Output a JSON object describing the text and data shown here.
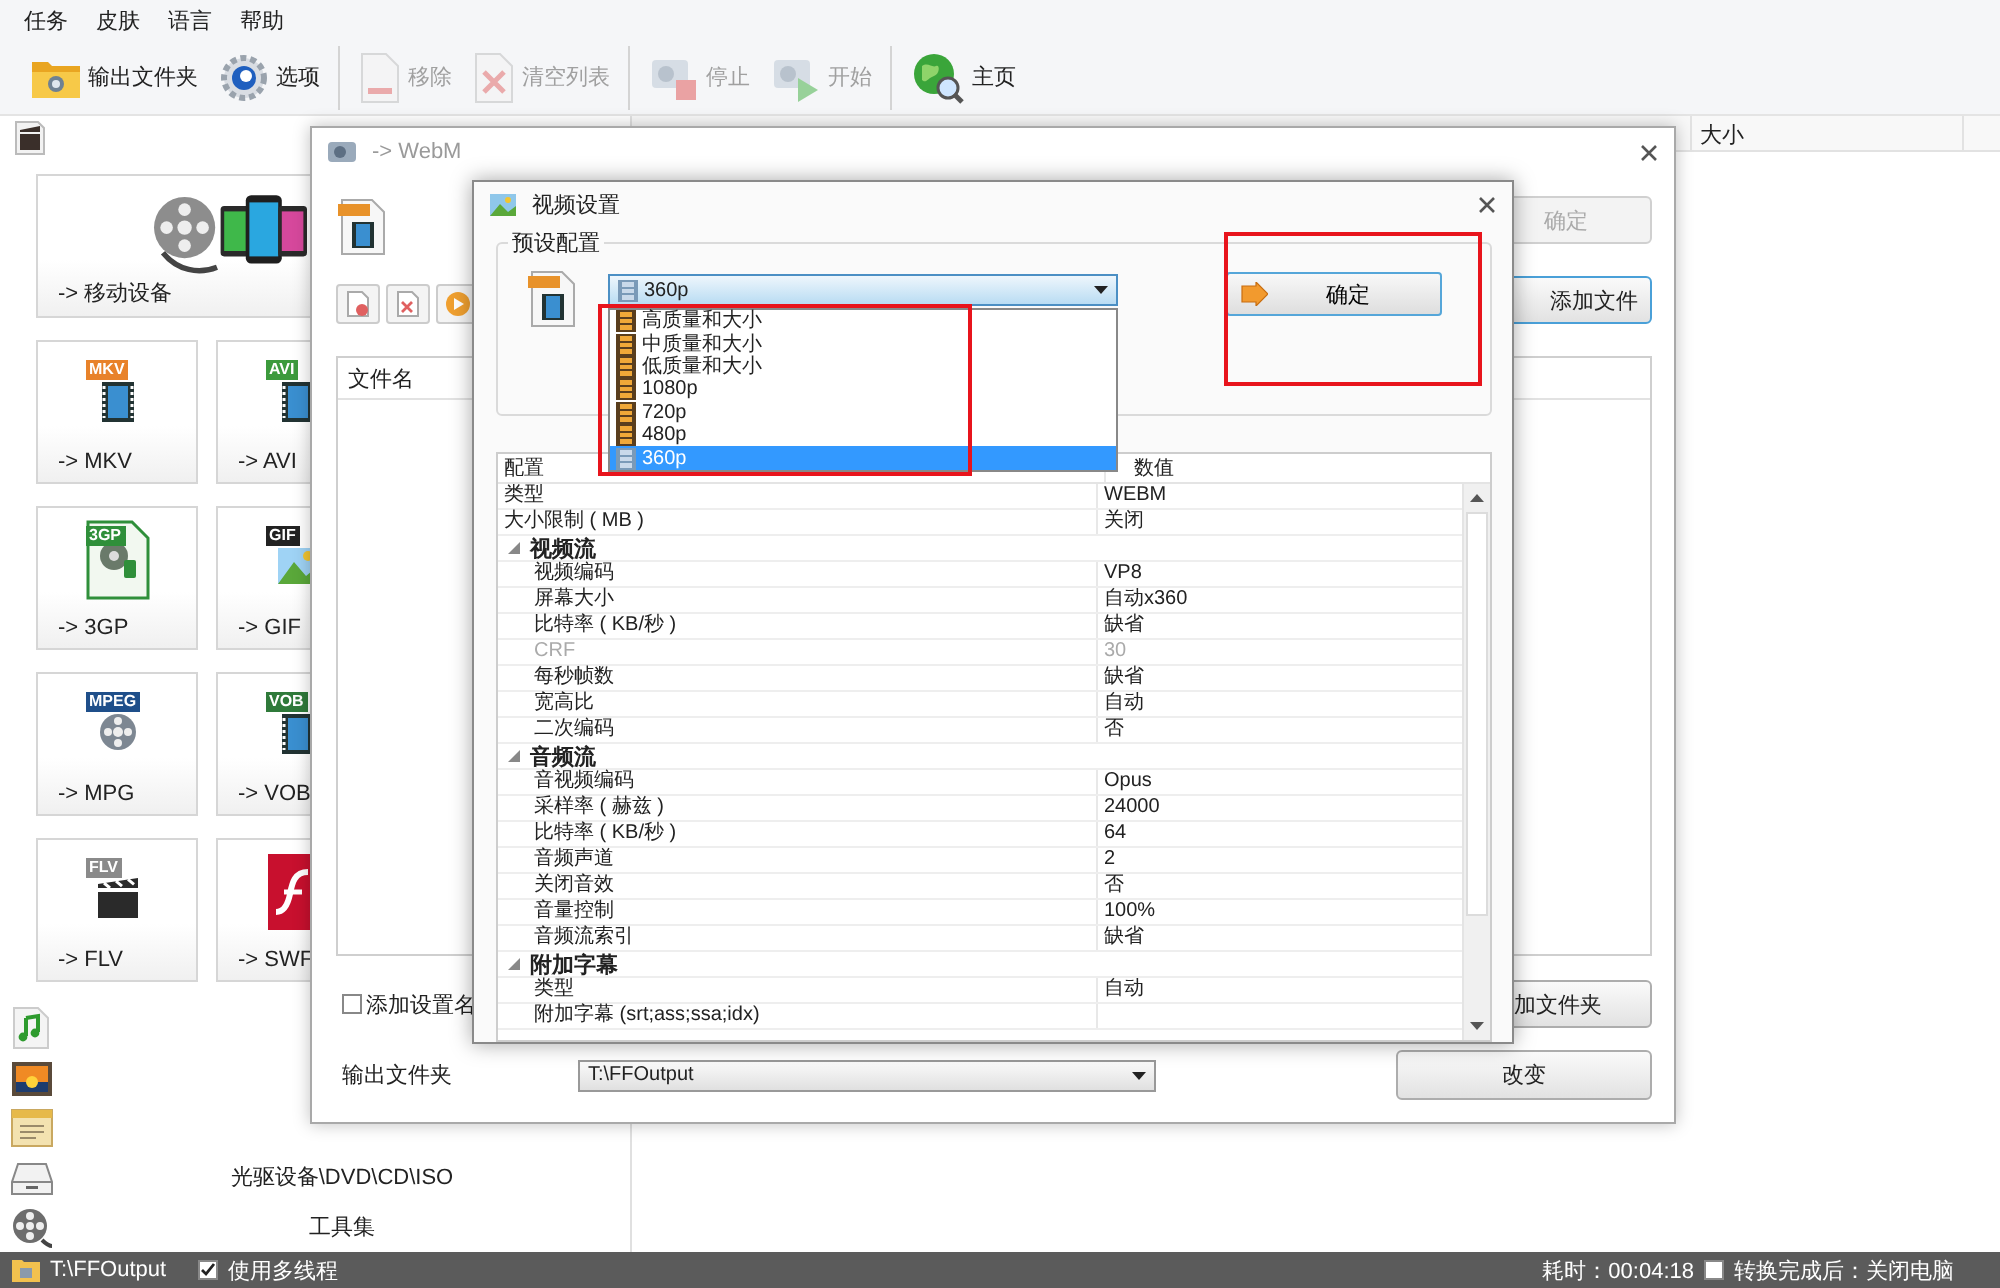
{
  "menu": [
    {
      "label": "任务"
    },
    {
      "label": "皮肤"
    },
    {
      "label": "语言"
    },
    {
      "label": "帮助"
    }
  ],
  "toolbar": [
    [
      {
        "label": "输出文件夹",
        "kind": "folder",
        "disabled": false
      },
      {
        "label": "选项",
        "kind": "gear",
        "disabled": false
      }
    ],
    [
      {
        "label": "移除",
        "kind": "remove",
        "disabled": true
      },
      {
        "label": "清空列表",
        "kind": "clear",
        "disabled": true
      }
    ],
    [
      {
        "label": "停止",
        "kind": "stop",
        "disabled": true
      },
      {
        "label": "开始",
        "kind": "start",
        "disabled": true
      }
    ],
    [
      {
        "label": "主页",
        "kind": "globe",
        "disabled": false
      }
    ]
  ],
  "left_panel": {
    "featured_tile": {
      "label": "-> 移动设备"
    },
    "tiles": [
      {
        "label": "-> MKV",
        "badge": "MKV",
        "kind": "film",
        "color": "#e8822a"
      },
      {
        "label": "-> AVI",
        "badge": "AVI",
        "kind": "film",
        "color": "#3c9a3c"
      },
      {
        "label": "-> 3GP",
        "badge": "3GP",
        "kind": "phone",
        "color": "#2f8f3a"
      },
      {
        "label": "-> GIF",
        "badge": "GIF",
        "kind": "image",
        "color": "#222222"
      },
      {
        "label": "-> MPG",
        "badge": "MPEG",
        "kind": "reel",
        "color": "#1f4f8a"
      },
      {
        "label": "-> VOB",
        "badge": "VOB",
        "kind": "film",
        "color": "#2f7a3a"
      },
      {
        "label": "-> FLV",
        "badge": "FLV",
        "kind": "clapper",
        "color": "#8a8a8a"
      },
      {
        "label": "-> SWF",
        "kind": "flash"
      }
    ],
    "sidebar_items": [
      {
        "kind": "music"
      },
      {
        "kind": "image"
      },
      {
        "kind": "document"
      },
      {
        "kind": "disc",
        "label": "光驱设备\\DVD\\CD\\ISO"
      },
      {
        "kind": "tools",
        "label": "工具集"
      }
    ]
  },
  "file_table": {
    "columns": [
      {
        "label": "大小"
      }
    ]
  },
  "webm_window": {
    "title": "-> WebM",
    "ok_button": {
      "label": "确定",
      "disabled": true
    },
    "add_file_button": {
      "label": "添加文件"
    },
    "list_columns": [
      {
        "label": "文件名"
      }
    ],
    "name_checkbox": {
      "label": "添加设置名",
      "checked": false
    },
    "add_folder_button": {
      "label": "加文件夹"
    },
    "output_label": "输出文件夹",
    "output_select": {
      "value": "T:\\FFOutput"
    },
    "change_button": {
      "label": "改变"
    }
  },
  "video_settings": {
    "title": "视频设置",
    "preset_group": "预设配置",
    "preset_select": {
      "value": "360p",
      "expanded": true
    },
    "preset_options": [
      {
        "label": "高质量和大小",
        "selected": false
      },
      {
        "label": "中质量和大小",
        "selected": false
      },
      {
        "label": "低质量和大小",
        "selected": false
      },
      {
        "label": "1080p",
        "selected": false
      },
      {
        "label": "720p",
        "selected": false
      },
      {
        "label": "480p",
        "selected": false
      },
      {
        "label": "360p",
        "selected": true
      }
    ],
    "ok_button": {
      "label": "确定"
    },
    "grid": {
      "columns": [
        {
          "label": "配置"
        },
        {
          "label": "数值"
        }
      ],
      "rows": [
        {
          "kind": "property",
          "name": "类型",
          "value": "WEBM",
          "disabled": false
        },
        {
          "kind": "property",
          "name": "大小限制 ( MB )",
          "value": "关闭",
          "disabled": false
        },
        {
          "kind": "category",
          "name": "视频流",
          "expanded": true,
          "children": [
            {
              "kind": "property",
              "name": "视频编码",
              "value": "VP8",
              "disabled": false
            },
            {
              "kind": "property",
              "name": "屏幕大小",
              "value": "自动x360",
              "disabled": false
            },
            {
              "kind": "property",
              "name": "比特率 ( KB/秒 )",
              "value": "缺省",
              "disabled": false
            },
            {
              "kind": "property",
              "name": "CRF",
              "value": "30",
              "disabled": true
            },
            {
              "kind": "property",
              "name": "每秒帧数",
              "value": "缺省",
              "disabled": false
            },
            {
              "kind": "property",
              "name": "宽高比",
              "value": "自动",
              "disabled": false
            },
            {
              "kind": "property",
              "name": "二次编码",
              "value": "否",
              "disabled": false
            }
          ]
        },
        {
          "kind": "category",
          "name": "音频流",
          "expanded": true,
          "children": [
            {
              "kind": "property",
              "name": "音视频编码",
              "value": "Opus",
              "disabled": false
            },
            {
              "kind": "property",
              "name": "采样率 ( 赫兹 )",
              "value": "24000",
              "disabled": false
            },
            {
              "kind": "property",
              "name": "比特率 ( KB/秒 )",
              "value": "64",
              "disabled": false
            },
            {
              "kind": "property",
              "name": "音频声道",
              "value": "2",
              "disabled": false
            },
            {
              "kind": "property",
              "name": "关闭音效",
              "value": "否",
              "disabled": false
            },
            {
              "kind": "property",
              "name": "音量控制",
              "value": "100%",
              "disabled": false
            },
            {
              "kind": "property",
              "name": "音频流索引",
              "value": "缺省",
              "disabled": false
            }
          ]
        },
        {
          "kind": "category",
          "name": "附加字幕",
          "expanded": true,
          "children": [
            {
              "kind": "property",
              "name": "类型",
              "value": "自动",
              "disabled": false
            },
            {
              "kind": "property",
              "name": "附加字幕 (srt;ass;ssa;idx)",
              "disabled": false
            }
          ]
        }
      ]
    }
  },
  "status_bar": {
    "path": "T:\\FFOutput",
    "multithread": {
      "label": "使用多线程",
      "checked": true
    },
    "elapsed": "耗时：00:04:18",
    "shutdown": {
      "label": "转换完成后：关闭电脑",
      "checked": false
    }
  }
}
